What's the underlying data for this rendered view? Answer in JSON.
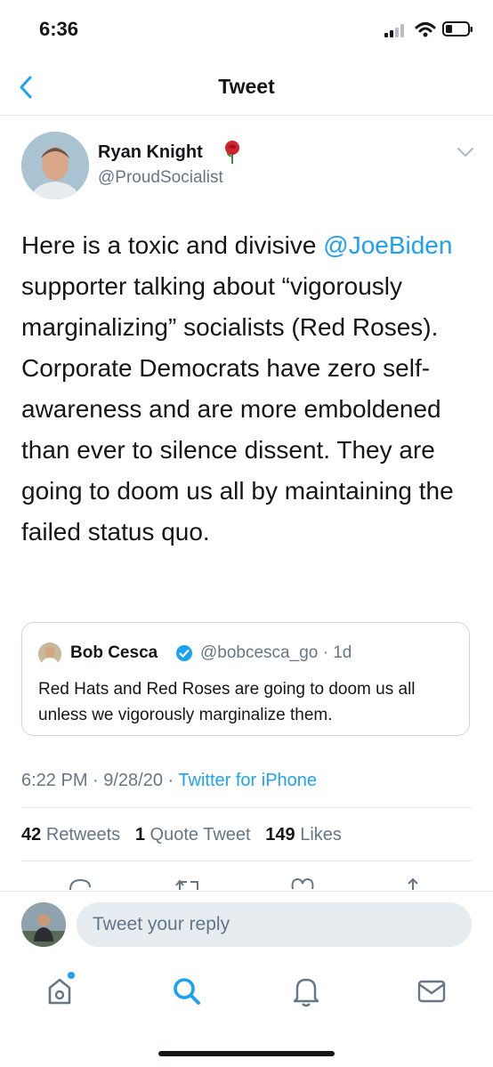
{
  "status_bar": {
    "time": "6:36"
  },
  "header": {
    "title": "Tweet"
  },
  "tweet": {
    "author_name": "Ryan Knight",
    "author_handle": "@ProudSocialist",
    "text_part1": "Here is a toxic and divisive ",
    "mention": "@JoeBiden",
    "text_part2": " supporter talking about “vigorously marginalizing” socialists (Red Roses). Corporate Democrats have zero self-awareness and are more emboldened than ever to silence dissent. They are going to doom us all by maintaining the failed status quo.",
    "time": "6:22 PM · 9/28/20 · ",
    "source": "Twitter for iPhone"
  },
  "quote": {
    "author_name": "Bob Cesca",
    "author_handle": "@bobcesca_go · 1d",
    "text": "Red Hats and Red Roses are going to doom us all unless we vigorously marginalize them."
  },
  "stats": {
    "retweets_count": "42",
    "retweets_label": "Retweets",
    "quote_count": "1",
    "quote_label": "Quote Tweet",
    "likes_count": "149",
    "likes_label": "Likes"
  },
  "reply": {
    "placeholder": "Tweet your reply"
  },
  "tab_bar": {
    "items": [
      "home-icon",
      "search-icon",
      "notifications-icon",
      "messages-icon"
    ]
  },
  "colors": {
    "accent": "#1da1f2",
    "secondary_text": "#657786",
    "rose": "#d0232d"
  }
}
